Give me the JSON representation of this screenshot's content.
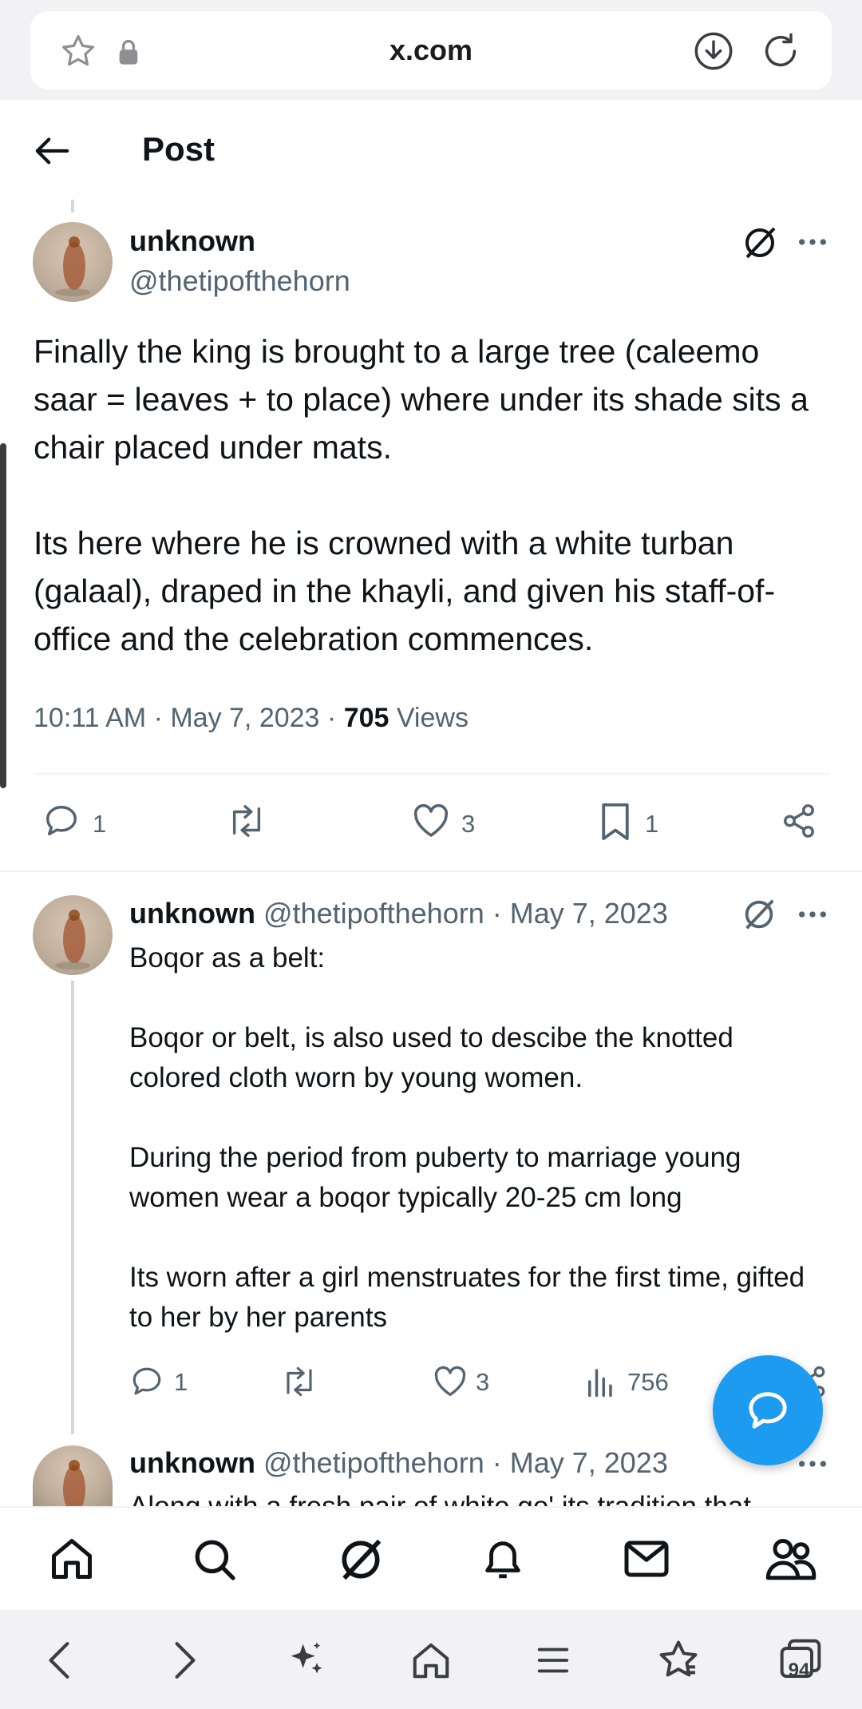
{
  "browser": {
    "url": "x.com",
    "tab_count": "94"
  },
  "header": {
    "title": "Post"
  },
  "main_post": {
    "name": "unknown",
    "handle": "@thetipofthehorn",
    "text": "Finally the king is brought to a large tree (caleemo saar = leaves + to place) where under its shade sits a chair placed under mats.\n\nIts here where he is crowned with a white turban (galaal), draped in the khayli, and given his staff-of-office and the celebration commences.",
    "time": "10:11 AM · May 7, 2023 · ",
    "views_count": "705",
    "views_label": " Views",
    "replies": "1",
    "likes": "3",
    "bookmarks": "1"
  },
  "reply_1": {
    "name": "unknown",
    "handle": "@thetipofthehorn · May 7, 2023",
    "text": "Boqor as a belt:\n\nBoqor or belt, is also used to descibe the knotted colored cloth worn by young women.\n\nDuring the period from puberty to marriage young women wear a boqor typically 20-25 cm long\n\nIts worn after a girl menstruates for the first time, gifted to her by her parents",
    "replies": "1",
    "likes": "3",
    "views": "756"
  },
  "reply_2": {
    "name": "unknown",
    "handle": "@thetipofthehorn · May 7, 2023",
    "text": "Along with a fresh pair of white go' its tradition that"
  },
  "colors": {
    "accent": "#1d9bf0",
    "text": "#0f1419",
    "secondary": "#536471"
  }
}
